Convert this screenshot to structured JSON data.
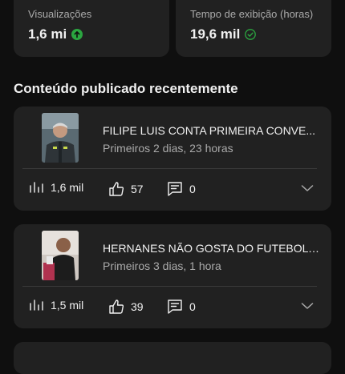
{
  "stats": {
    "views": {
      "label": "Visualizações",
      "value": "1,6 mi",
      "trend_color": "#2ba640"
    },
    "watch_time": {
      "label": "Tempo de exibição (horas)",
      "value": "19,6 mil",
      "status_color": "#2ba640"
    }
  },
  "section": {
    "title": "Conteúdo publicado recentemente"
  },
  "videos": [
    {
      "title": "FILIPE LUIS CONTA PRIMEIRA CONVE...",
      "age": "Primeiros 2 dias, 23 horas",
      "views": "1,6 mil",
      "likes": "57",
      "comments": "0"
    },
    {
      "title": "HERNANES NÃO GOSTA DO FUTEBOL ...",
      "age": "Primeiros 3 dias, 1 hora",
      "views": "1,5 mil",
      "likes": "39",
      "comments": "0"
    }
  ]
}
